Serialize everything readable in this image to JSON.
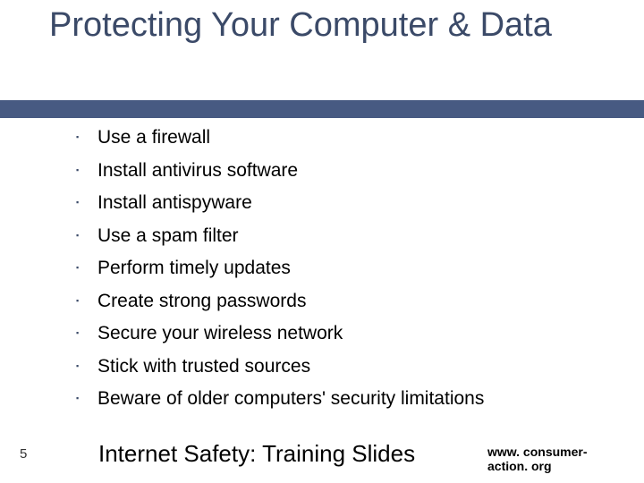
{
  "slide": {
    "title": "Protecting Your Computer & Data",
    "bullets": [
      "Use a firewall",
      "Install antivirus software",
      "Install antispyware",
      "Use a spam filter",
      "Perform timely updates",
      "Create strong passwords",
      "Secure your wireless network",
      "Stick with trusted sources",
      "Beware of older computers' security limitations"
    ],
    "footer": {
      "page": "5",
      "caption": "Internet Safety: Training Slides",
      "url_line1": "www. consumer-",
      "url_line2": "action. org"
    }
  },
  "colors": {
    "accent": "#475a82",
    "title": "#3b4a68"
  }
}
